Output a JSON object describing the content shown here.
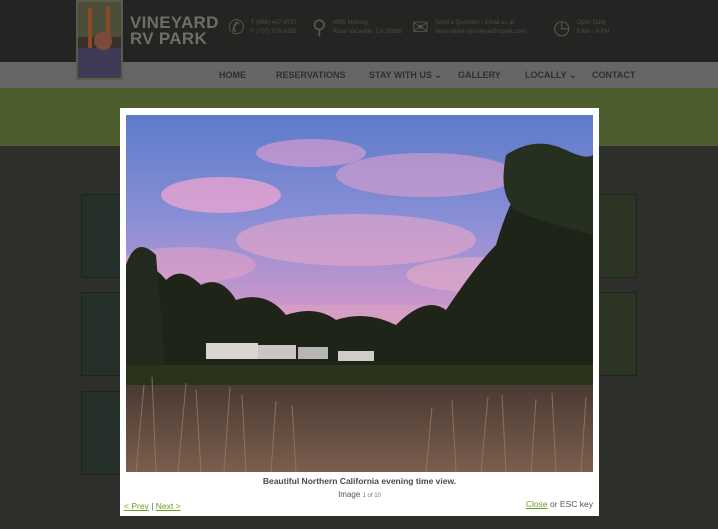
{
  "site": {
    "name_line1": "VINEYARD",
    "name_line2": "RV PARK"
  },
  "contact": {
    "phone": {
      "icon": "phone-icon",
      "line1": "T (866) 447-8797",
      "line2": "F (707) 678-8381"
    },
    "address": {
      "icon": "location-pin-icon",
      "line1": "4985 Midway",
      "line2": "Road Vacaville, CA 95688"
    },
    "email": {
      "icon": "envelope-icon",
      "line1": "Send a Question / Email us at",
      "line2": "reservations@vineyardrvpark.com"
    },
    "hours": {
      "icon": "clock-icon",
      "line1": "Open Daily",
      "line2": "8 AM - 9 PM"
    }
  },
  "nav": {
    "items": [
      {
        "label": "HOME"
      },
      {
        "label": "RESERVATIONS"
      },
      {
        "label": "STAY WITH US ⌄"
      },
      {
        "label": "GALLERY"
      },
      {
        "label": "LOCALLY ⌄"
      },
      {
        "label": "CONTACT"
      }
    ]
  },
  "lightbox": {
    "caption": "Beautiful Northern California evening time view.",
    "image_word": "Image",
    "counter": "1 of 10",
    "prev_label": "< Prev",
    "separator": "|",
    "next_label": "Next >",
    "close_label": "Close",
    "close_suffix": "or ESC key"
  },
  "colors": {
    "link": "#6e9e1f",
    "overlay_green": "#4d5d2e"
  }
}
